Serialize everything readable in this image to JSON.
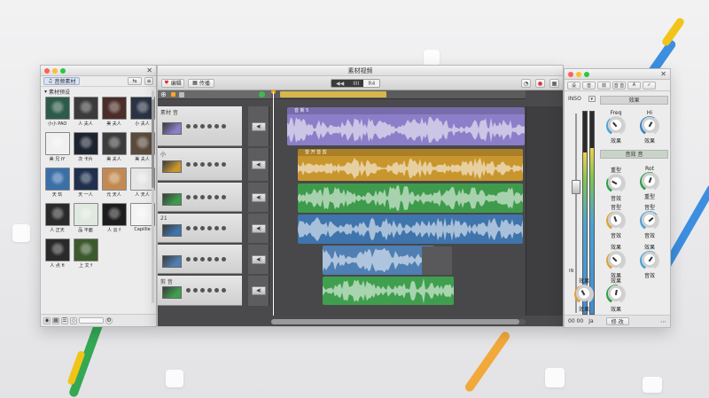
{
  "browser": {
    "tab_label": "音频素材",
    "section_label": "素材预设",
    "items": [
      {
        "label": "小小 PAO",
        "color": "#2d5b4a"
      },
      {
        "label": "人 夫人",
        "color": "#3b3b3b"
      },
      {
        "label": "美 夫人",
        "color": "#4b2e2a"
      },
      {
        "label": "小 夫人",
        "color": "#2a3344"
      },
      {
        "label": "美 兄 IY",
        "color": "#f0f0f0"
      },
      {
        "label": "次 卡片",
        "color": "#1d2430"
      },
      {
        "label": "美 夫人",
        "color": "#3c3c3c"
      },
      {
        "label": "美 夫人",
        "color": "#5a4a3c"
      },
      {
        "label": "天 玖",
        "color": "#3a6fa8"
      },
      {
        "label": "天 一人",
        "color": "#20304d"
      },
      {
        "label": "元 天人",
        "color": "#c28a52"
      },
      {
        "label": "人 天人",
        "color": "#e6e6e6"
      },
      {
        "label": "人 正天",
        "color": "#2a2a2a"
      },
      {
        "label": "品 平面",
        "color": "#dfe9df"
      },
      {
        "label": "人 云 f",
        "color": "#1c1c1c"
      },
      {
        "label": "Capillie",
        "color": "#f4f4f4"
      },
      {
        "label": "人 点 fi",
        "color": "#2a2a2a"
      },
      {
        "label": "上 文 f",
        "color": "#3d5a2e"
      }
    ]
  },
  "daw": {
    "title": "素材视频",
    "toolbar_left": [
      "编辑",
      "传播"
    ],
    "transport": [
      "",
      "IIII",
      "R4"
    ],
    "tracks": [
      {
        "name": "素材 音",
        "clip_label": "音 新 5",
        "color": "#8c7ec8"
      },
      {
        "name": "小",
        "clip_label": "音 开 音 剪",
        "color": "#c9962e"
      },
      {
        "name": "",
        "clip_label": "",
        "color": "#3e9b4c"
      },
      {
        "name": "21",
        "clip_label": "",
        "color": "#3f74ac"
      },
      {
        "name": "",
        "clip_label": "",
        "color": "#4f7fb3"
      },
      {
        "name": "剪 音",
        "clip_label": "",
        "color": "#3f9f4e"
      }
    ]
  },
  "inspector": {
    "tabs": [
      "设",
      "音",
      "效",
      "音 音",
      "A",
      "✓"
    ],
    "header": "效果",
    "sub_header": "音效 音",
    "panel_label": "INSO",
    "knobs": [
      {
        "label": "Freq",
        "value_label": "效果"
      },
      {
        "label": "Hi",
        "value_label": "效果"
      },
      {
        "label": "重型",
        "value_label": "音效"
      },
      {
        "label": "Rot",
        "value_label": "重型"
      },
      {
        "label": "音型",
        "value_label": "音效"
      },
      {
        "label": "音型",
        "value_label": "音效"
      },
      {
        "label": "效果",
        "value_label": "效果"
      },
      {
        "label": "效果",
        "value_label": "音效"
      },
      {
        "label": "效果",
        "value_label": "效果"
      },
      {
        "label": "效果",
        "value_label": "效果"
      }
    ],
    "meter_label": "IN",
    "bottom_left": "00 00",
    "bottom_right": "修 改",
    "bottom_label": "Ja"
  }
}
